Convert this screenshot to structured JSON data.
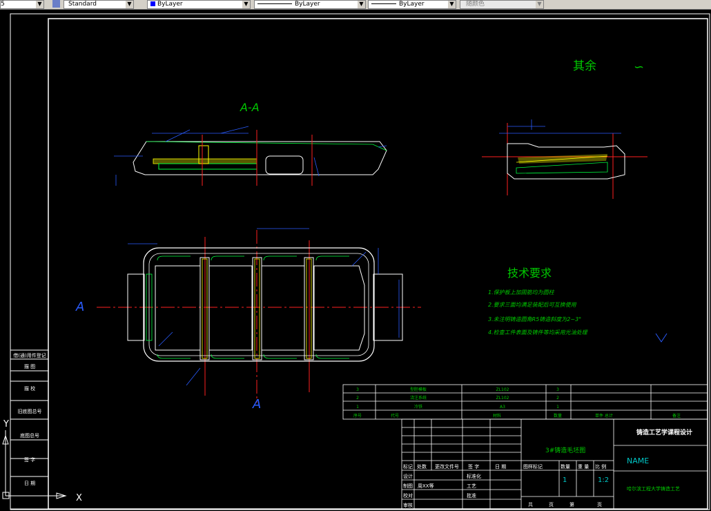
{
  "toolbar": {
    "layer_value": "5",
    "text_style": "Standard",
    "color": "ByLayer",
    "linetype": "ByLayer",
    "lineweight": "ByLayer",
    "plot_style": "随颜色"
  },
  "drawing": {
    "section_label": "A-A",
    "cut_label_left": "A",
    "cut_label_bottom": "A",
    "roughness_prefix": "其余",
    "roughness_symbol": "∽",
    "tech_title": "技术要求",
    "tech_items": [
      "1.保护板上加固筋均为圆柱",
      "2.要求三面均满足装配后可互换使用",
      "3.未注明铸造圆角R5铸造斜度为2~3°",
      "4.检查工件表面及铸件等均采用光油处理"
    ]
  },
  "left_strip": {
    "items": [
      "借(通)用件登记",
      "描 图",
      "描 校",
      "旧底图总号",
      "底图总号",
      "签 字",
      "日 期"
    ]
  },
  "parts_list": {
    "rows": [
      {
        "no": "3",
        "name": "型腔模板",
        "material": "ZL102",
        "qty": "3"
      },
      {
        "no": "2",
        "name": "浇注系统",
        "material": "ZL102",
        "qty": "2"
      },
      {
        "no": "1",
        "name": "冷铁",
        "material": "A3",
        "qty": "1"
      }
    ],
    "header": [
      "序号",
      "代号",
      "名称",
      "材料",
      "数量",
      "单件 总计",
      "重量",
      "备注"
    ]
  },
  "title_block": {
    "part_name": "3#铸造毛坯图",
    "course": "铸造工艺学课程设计",
    "name": "NAME",
    "school": "哈尔滨工程大学铸造工艺",
    "labels_row": [
      "标记",
      "处数",
      "更改文件号",
      "签 字",
      "日 期"
    ],
    "left_rows": [
      "设计",
      "制图",
      "校对",
      "审核"
    ],
    "left_values": [
      "",
      "周XX等",
      "",
      ""
    ],
    "mid_rows": [
      "标准化",
      "工艺",
      "批准"
    ],
    "stage_label": "图样标记",
    "qty_label": "数量",
    "weight_label": "重 量",
    "scale_label": "比 例",
    "qty_value": "1",
    "scale_value": "1:2",
    "sheet_total": "共",
    "sheet_unit": "页",
    "sheet_no": "第",
    "sheet_unit2": "页"
  },
  "ucs": {
    "y": "Y",
    "x": "X"
  },
  "colors": {
    "background": "#000000",
    "outline": "#ffffff",
    "dim": "#2a5cff",
    "center": "#ff2020",
    "hatch": "#ffff00",
    "fill": "#00ff40",
    "text": "#00c800",
    "dim_text": "#00c8c8"
  }
}
